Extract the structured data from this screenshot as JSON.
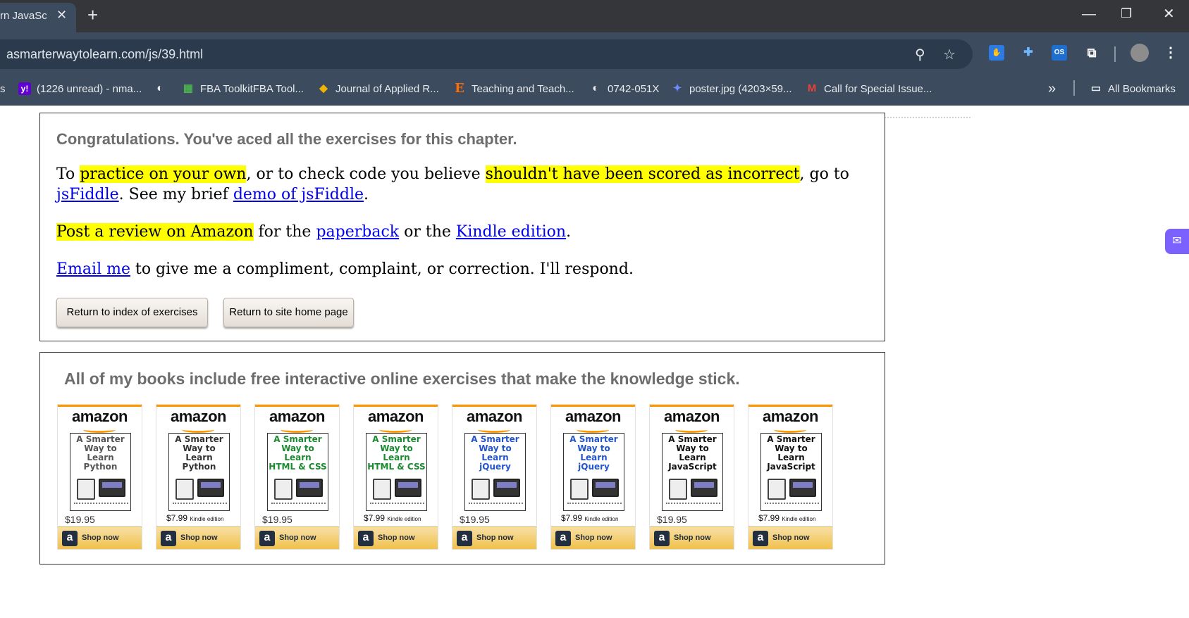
{
  "browser": {
    "tab_title": "rn JavaScr",
    "tab_close": "✕",
    "new_tab": "+",
    "window_controls": {
      "minimize": "—",
      "restore": "❐",
      "close": "✕"
    },
    "url": "asmarterwaytolearn.com/js/39.html",
    "bookmarks": [
      {
        "label": "(1226 unread) - nma...",
        "icon": "yahoo-icon",
        "glyph": "y!",
        "color": "#6001d2"
      },
      {
        "label": "",
        "icon": "globe-icon",
        "glyph": "◐",
        "color": "#e8eaed"
      },
      {
        "label": "FBA ToolkitFBA Tool...",
        "icon": "image-icon",
        "glyph": "▦",
        "color": "#4caf50"
      },
      {
        "label": "Journal of Applied R...",
        "icon": "journal-icon",
        "glyph": "◆",
        "color": "#f0b400"
      },
      {
        "label": "Teaching and Teach...",
        "icon": "elsevier-icon",
        "glyph": "E",
        "color": "#ff6c00"
      },
      {
        "label": "0742-051X",
        "icon": "globe-icon",
        "glyph": "◐",
        "color": "#e8eaed"
      },
      {
        "label": "poster.jpg (4203×59...",
        "icon": "poster-icon",
        "glyph": "✦",
        "color": "#6c8cff"
      },
      {
        "label": "Call for Special Issue...",
        "icon": "gmail-icon",
        "glyph": "M",
        "color": "#ea4335"
      }
    ],
    "bookmarks_overflow": "»",
    "all_bookmarks": "All Bookmarks",
    "bookmark_prefix": "s"
  },
  "congrats": {
    "heading": "Congratulations. You've aced all the exercises for this chapter.",
    "p1": {
      "t1": "To ",
      "h1": "practice on your own",
      "t2": ", or to check code you believe ",
      "h2": "shouldn't have been scored as incorrect",
      "t3": ", go to ",
      "link1": "jsFiddle",
      "t4": ". See my brief ",
      "link2": "demo of jsFiddle",
      "t5": "."
    },
    "p2": {
      "h1": "Post a review on Amazon",
      "t1": " for the ",
      "link1": "paperback",
      "t2": " or the ",
      "link2": "Kindle edition",
      "t3": "."
    },
    "p3": {
      "link1": "Email me",
      "t1": " to give me a compliment, complaint, or correction. I'll respond."
    },
    "buttons": {
      "index": "Return to index of exercises",
      "home": "Return to site home page"
    }
  },
  "books": {
    "heading": "All of my books include free interactive online exercises that make the knowledge stick.",
    "logo": "amazon",
    "shop_label": "Shop now",
    "shop_icon_glyph": "a",
    "kindle_suffix": "Kindle edition",
    "items": [
      {
        "title": [
          "A Smarter",
          "Way to",
          "Learn",
          "Python"
        ],
        "price": "$19.95",
        "kindle": false,
        "title_color": "#555555"
      },
      {
        "title": [
          "A Smarter",
          "Way to",
          "Learn",
          "Python"
        ],
        "price": "$7.99",
        "kindle": true,
        "title_color": "#333333"
      },
      {
        "title": [
          "A Smarter",
          "Way to",
          "Learn",
          "HTML & CSS"
        ],
        "price": "$19.95",
        "kindle": false,
        "title_color": "#1a8a2e"
      },
      {
        "title": [
          "A Smarter",
          "Way to",
          "Learn",
          "HTML & CSS"
        ],
        "price": "$7.99",
        "kindle": true,
        "title_color": "#1a8a2e"
      },
      {
        "title": [
          "A Smarter",
          "Way to",
          "Learn",
          "jQuery"
        ],
        "price": "$19.95",
        "kindle": false,
        "title_color": "#2255cc"
      },
      {
        "title": [
          "A Smarter",
          "Way to",
          "Learn",
          "jQuery"
        ],
        "price": "$7.99",
        "kindle": true,
        "title_color": "#2255cc"
      },
      {
        "title": [
          "A Smarter",
          "Way to",
          "Learn",
          "JavaScript"
        ],
        "price": "$19.95",
        "kindle": false,
        "title_color": "#111111"
      },
      {
        "title": [
          "A Smarter",
          "Way to",
          "Learn",
          "JavaScript"
        ],
        "price": "$7.99",
        "kindle": true,
        "title_color": "#111111"
      }
    ]
  },
  "colors": {
    "highlight": "#ffff00",
    "link": "#0000ee",
    "amazon_orange": "#ff9900",
    "chrome_dark": "#35363a",
    "chrome_toolbar": "#3c4b5e"
  }
}
